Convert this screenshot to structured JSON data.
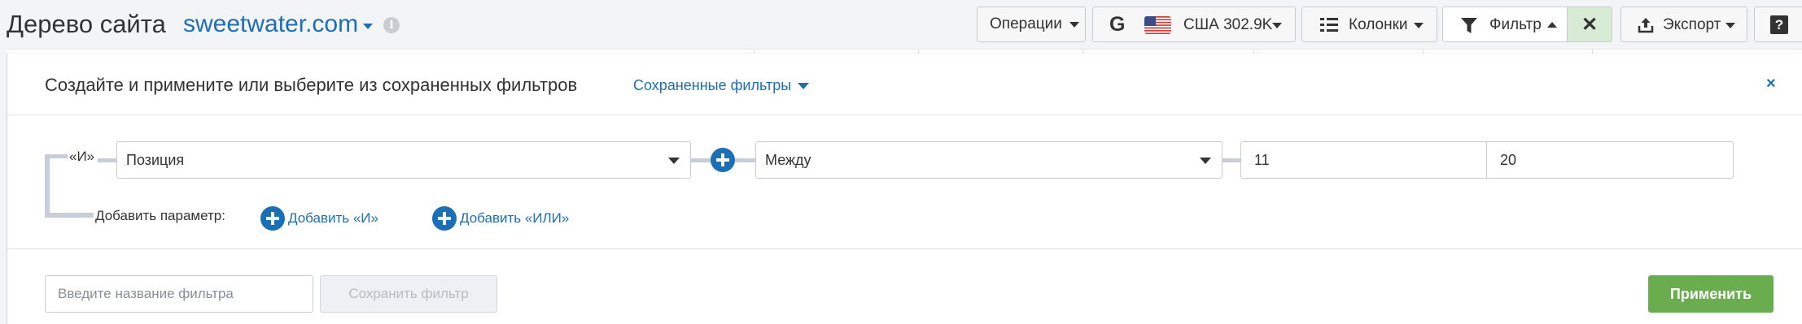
{
  "header": {
    "title": "Дерево сайта",
    "domain": "sweetwater.com",
    "info_icon": "info-icon"
  },
  "toolbar": {
    "operations_label": "Операции",
    "db_engine_icon": "google-icon",
    "db_country_flag": "us-flag-icon",
    "db_label": "США 302.9K",
    "columns_label": "Колонки",
    "filter_label": "Фильтр",
    "export_label": "Экспорт",
    "help_label": "?"
  },
  "filter_panel": {
    "title": "Создайте и примените или выберите из сохраненных фильтров",
    "saved_filters_label": "Сохраненные фильтры",
    "close_label": "×",
    "condition": {
      "logic_label": "«И»",
      "parameter": "Позиция",
      "operator": "Между",
      "value_from": "11",
      "value_to": "20"
    },
    "add_param_label": "Добавить параметр:",
    "add_and_label": "Добавить «И»",
    "add_or_label": "Добавить «ИЛИ»",
    "filter_name_placeholder": "Введите название фильтра",
    "save_filter_label": "Сохранить фильтр",
    "apply_label": "Применить"
  },
  "colors": {
    "link_blue": "#1c6fb4",
    "apply_green": "#6aad4f",
    "filter_active_bg": "#d8ecd5"
  }
}
